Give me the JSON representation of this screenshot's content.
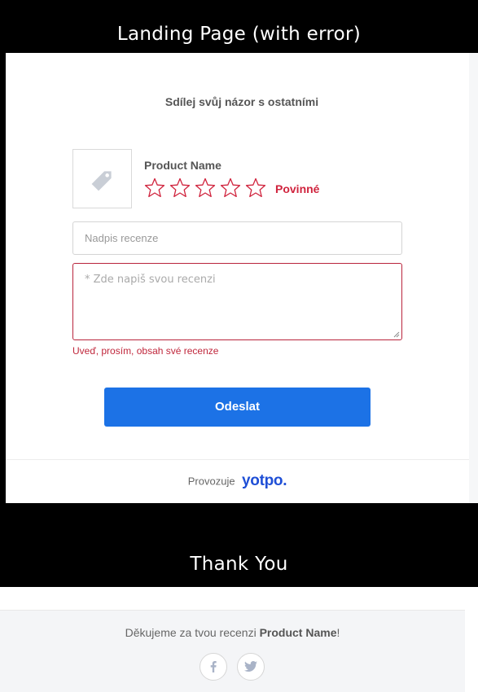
{
  "sections": {
    "landing_title": "Landing Page (with error)",
    "thankyou_title": "Thank You"
  },
  "form": {
    "heading": "Sdílej svůj názor s ostatními",
    "product_name": "Product Name",
    "rating_required": "Povinné",
    "title_placeholder": "Nadpis recenze",
    "review_placeholder": "* Zde napiš svou recenzi",
    "error_message": "Uveď, prosím, obsah své recenze",
    "submit_label": "Odeslat",
    "powered_by": "Provozuje",
    "brand": "yotpo."
  },
  "thankyou": {
    "text_prefix": "Děkujeme za tvou recenzi ",
    "product_name": "Product Name",
    "text_suffix": "!"
  },
  "colors": {
    "error": "#d0243e",
    "accent": "#1c72e6",
    "brand": "#1f4fd6"
  },
  "icons": {
    "product_placeholder": "tag-icon",
    "facebook": "facebook-icon",
    "twitter": "twitter-icon"
  }
}
